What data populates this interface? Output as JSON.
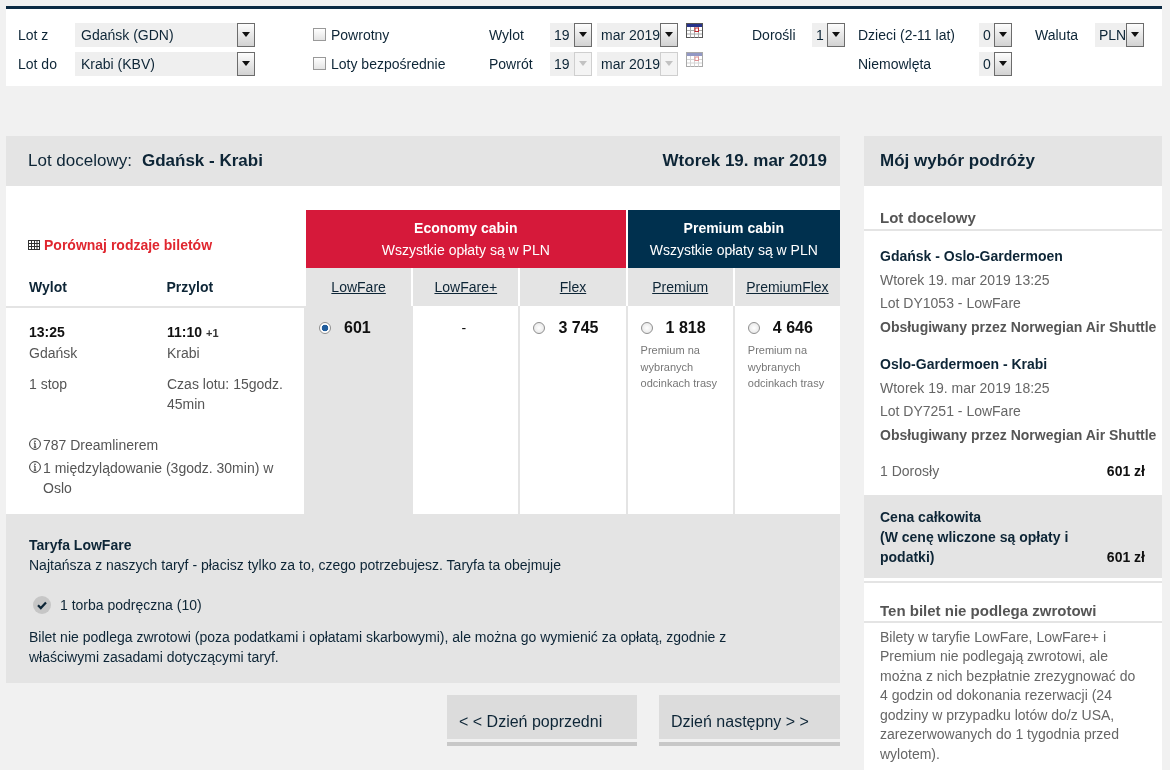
{
  "search_form": {
    "from": {
      "label": "Lot z",
      "value": "Gdańsk (GDN)"
    },
    "to": {
      "label": "Lot do",
      "value": "Krabi (KBV)"
    },
    "options": [
      {
        "label": "Powrotny",
        "checked": false
      },
      {
        "label": "Loty bezpośrednie",
        "checked": false
      }
    ],
    "dates": [
      {
        "label": "Wylot",
        "day": "19",
        "month": "mar 2019",
        "disabled": false
      },
      {
        "label": "Powrót",
        "day": "19",
        "month": "mar 2019",
        "disabled": true
      }
    ],
    "passengers": [
      {
        "label": "Dorośli",
        "value": "1"
      },
      {
        "label": "Dzieci (2-11 lat)",
        "value": "0"
      },
      {
        "label": "Niemowlęta",
        "value": "0"
      }
    ],
    "currency": {
      "label": "Waluta",
      "value": "PLN"
    }
  },
  "outbound": {
    "label": "Lot docelowy:",
    "route": "Gdańsk - Krabi",
    "date": "Wtorek 19. mar 2019",
    "compare_link": "Porównaj rodzaje biletów",
    "headers": [
      "Wylot",
      "Przylot"
    ],
    "cabins": [
      {
        "name": "Economy cabin",
        "note": "Wszystkie opłaty są w PLN",
        "color": "#d6193a",
        "fares": [
          "LowFare",
          "LowFare+",
          "Flex"
        ]
      },
      {
        "name": "Premium cabin",
        "note": "Wszystkie opłaty są w PLN",
        "color": "#00304e",
        "fares": [
          "Premium",
          "PremiumFlex"
        ]
      }
    ],
    "flight": {
      "departure": {
        "time": "13:25",
        "city": "Gdańsk"
      },
      "arrival": {
        "time": "11:10",
        "day_offset": "+1",
        "city": "Krabi"
      },
      "stops": "1 stop",
      "duration": "Czas lotu: 15godz. 45min",
      "notes": [
        "787 Dreamlinerem",
        "1 międzylądowanie (3godz. 30min) w Oslo"
      ],
      "prices": [
        {
          "kind": "radio",
          "price": "601",
          "selected": true
        },
        {
          "kind": "unavailable",
          "price": "-",
          "selected": false
        },
        {
          "kind": "radio",
          "price": "3 745",
          "selected": false
        },
        {
          "kind": "radio",
          "price": "1 818",
          "selected": false,
          "note": "Premium na wybranych odcinkach trasy"
        },
        {
          "kind": "radio",
          "price": "4 646",
          "selected": false,
          "note": "Premium na wybranych odcinkach trasy"
        }
      ]
    }
  },
  "fare_info": {
    "title": "Taryfa LowFare",
    "description": "Najtańsza z naszych taryf - płacisz tylko za to, czego potrzebujesz. Taryfa ta obejmuje",
    "includes": [
      "1 torba podręczna (10)"
    ],
    "conditions": "Bilet nie podlega zwrotowi (poza podatkami i opłatami skarbowymi), ale można go wymienić za opłatą, zgodnie z właściwymi zasadami dotyczącymi taryf."
  },
  "day_nav": [
    "< < Dzień poprzedni",
    "Dzień następny > >"
  ],
  "summary": {
    "title": "Mój wybór podróży",
    "section": "Lot docelowy",
    "segments": [
      {
        "route": "Gdańsk - Oslo-Gardermoen",
        "datetime": "Wtorek 19. mar 2019 13:25",
        "flight": "Lot DY1053 - LowFare",
        "operator": "Obsługiwany przez Norwegian Air Shuttle"
      },
      {
        "route": "Oslo-Gardermoen - Krabi",
        "datetime": "Wtorek 19. mar 2019 18:25",
        "flight": "Lot DY7251 - LowFare",
        "operator": "Obsługiwany przez Norwegian Air Shuttle"
      }
    ],
    "passengers": {
      "label": "1 Dorosły",
      "price": "601 zł"
    },
    "total": {
      "label": "Cena całkowita",
      "note": "(W cenę wliczone są opłaty i podatki)",
      "price": "601 zł"
    },
    "refund": {
      "title": "Ten bilet nie podlega zwrotowi",
      "text": "Bilety w taryfie LowFare, LowFare+ i Premium nie podlegają zwrotowi, ale można z nich bezpłatnie zrezygnować do 4 godzin od dokonania rezerwacji (24 godziny w przypadku lotów do/z USA, zarezerwowanych do 1 tygodnia przed wylotem)."
    }
  }
}
